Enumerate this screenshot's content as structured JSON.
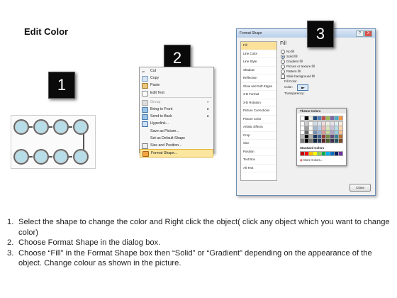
{
  "title": "Edit Color",
  "badges": [
    "1",
    "2",
    "3"
  ],
  "context_menu": {
    "items": [
      {
        "label": "Cut",
        "icon": "scissors-icon",
        "state": "normal"
      },
      {
        "label": "Copy",
        "icon": "copy-icon",
        "state": "normal"
      },
      {
        "label": "Paste",
        "icon": "paste-icon",
        "state": "normal"
      },
      {
        "label": "Edit Text",
        "icon": "edit-text-icon",
        "state": "normal"
      },
      {
        "label": "Group",
        "icon": "group-icon",
        "state": "disabled",
        "submenu": true
      },
      {
        "label": "Bring to Front",
        "icon": "bring-front-icon",
        "state": "normal",
        "submenu": true
      },
      {
        "label": "Send to Back",
        "icon": "send-back-icon",
        "state": "normal",
        "submenu": true
      },
      {
        "label": "Hyperlink...",
        "icon": "hyperlink-icon",
        "state": "normal"
      },
      {
        "label": "Save as Picture...",
        "icon": "",
        "state": "normal"
      },
      {
        "label": "Set as Default Shape",
        "icon": "",
        "state": "normal"
      },
      {
        "label": "Size and Position...",
        "icon": "size-icon",
        "state": "normal"
      },
      {
        "label": "Format Shape...",
        "icon": "format-shape-icon",
        "state": "highlighted"
      }
    ]
  },
  "dialog": {
    "title": "Format Shape",
    "help": "?",
    "close_x": "X",
    "categories": [
      "Fill",
      "Line Color",
      "Line Style",
      "Shadow",
      "Reflection",
      "Glow and Soft Edges",
      "3-D Format",
      "3-D Rotation",
      "Picture Corrections",
      "Picture Color",
      "Artistic Effects",
      "Crop",
      "Size",
      "Position",
      "Text Box",
      "Alt Text"
    ],
    "selected_category": "Fill",
    "heading": "Fill",
    "fill_options": [
      {
        "label": "No fill",
        "selected": false
      },
      {
        "label": "Solid fill",
        "selected": true
      },
      {
        "label": "Gradient fill",
        "selected": false
      },
      {
        "label": "Picture or texture fill",
        "selected": false
      },
      {
        "label": "Pattern fill",
        "selected": false
      }
    ],
    "slide_background": "Slide background fill",
    "fill_color_label": "Fill Color",
    "color_label": "Color:",
    "transparency_label": "Transparency:",
    "close_button": "Close"
  },
  "palette": {
    "theme_label": "Theme Colors",
    "standard_label": "Standard Colors",
    "more_label": "More Colors...",
    "theme_columns": [
      "#ffffff",
      "#000000",
      "#eeece1",
      "#1f497d",
      "#4f81bd",
      "#c0504d",
      "#9bbb59",
      "#8064a2",
      "#4bacc6",
      "#f79646"
    ],
    "standard": [
      "#c00000",
      "#ff0000",
      "#ffc000",
      "#ffff00",
      "#92d050",
      "#00b050",
      "#00b0f0",
      "#0070c0",
      "#002060",
      "#7030a0"
    ]
  },
  "instructions": [
    {
      "num": "1.",
      "text": "Select the shape to change the color and Right click the object( click any object which you want to change color)"
    },
    {
      "num": "2.",
      "text": "Choose Format Shape in the dialog box."
    },
    {
      "num": "3.",
      "text": "Choose “Fill” in the Format Shape box then “Solid” or “Gradient” depending on the appearance of the object. Change colour as shown in the picture."
    }
  ]
}
